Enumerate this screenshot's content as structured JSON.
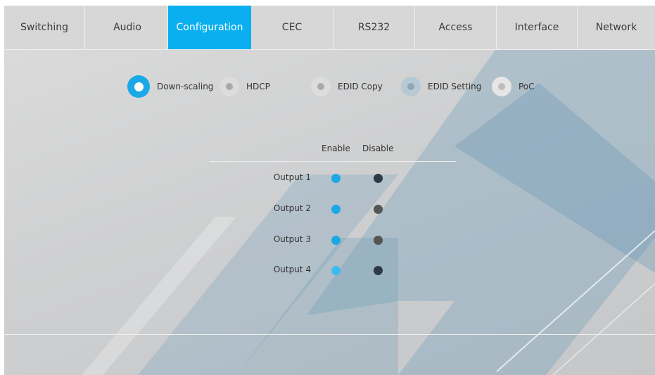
{
  "tabs": [
    {
      "label": "Switching",
      "active": false
    },
    {
      "label": "Audio",
      "active": false
    },
    {
      "label": "Configuration",
      "active": true
    },
    {
      "label": "CEC",
      "active": false
    },
    {
      "label": "RS232",
      "active": false
    },
    {
      "label": "Access",
      "active": false
    },
    {
      "label": "Interface",
      "active": false
    },
    {
      "label": "Network",
      "active": false
    }
  ],
  "sub_options": [
    {
      "label": "Down-scaling",
      "selected": true
    },
    {
      "label": "HDCP",
      "selected": false
    },
    {
      "label": "EDID Copy",
      "selected": false
    },
    {
      "label": "EDID Setting",
      "selected": false
    },
    {
      "label": "PoC",
      "selected": false
    }
  ],
  "table": {
    "enable_header": "Enable",
    "disable_header": "Disable",
    "rows": [
      {
        "label": "Output 1",
        "value": "Enable"
      },
      {
        "label": "Output 2",
        "value": "Enable"
      },
      {
        "label": "Output 3",
        "value": "Enable"
      },
      {
        "label": "Output 4",
        "value": "Enable"
      }
    ]
  },
  "colors": {
    "accent": "#0aaff0",
    "enable_dot": "#1ca8e3",
    "disable_dot": "#2b3a44"
  }
}
